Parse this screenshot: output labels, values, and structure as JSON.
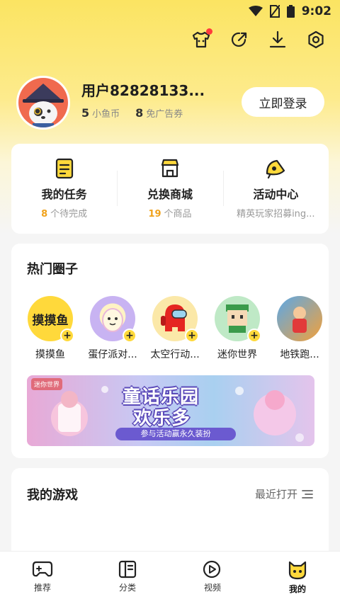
{
  "status_bar": {
    "time": "9:02"
  },
  "profile": {
    "username": "用户82828133...",
    "coins_value": "5",
    "coins_label": "小鱼币",
    "adfree_value": "8",
    "adfree_label": "免广告券",
    "login_label": "立即登录"
  },
  "quick": [
    {
      "title": "我的任务",
      "num": "8",
      "sub": "个待完成",
      "icon": "task-icon"
    },
    {
      "title": "兑换商城",
      "num": "19",
      "sub": "个商品",
      "icon": "shop-icon"
    },
    {
      "title": "活动中心",
      "num": "",
      "sub": "精英玩家招募ing...",
      "icon": "activity-icon"
    }
  ],
  "hot_circles": {
    "title": "热门圈子",
    "items": [
      {
        "name": "摸摸鱼",
        "icon_text": "摸摸鱼"
      },
      {
        "name": "蛋仔派对..."
      },
      {
        "name": "太空行动..."
      },
      {
        "name": "迷你世界"
      },
      {
        "name": "地铁跑..."
      }
    ],
    "banner": {
      "logo": "迷你世界",
      "title_line1": "童话乐园",
      "title_line2": "欢乐多",
      "subtitle": "参与活动赢永久装扮"
    }
  },
  "my_games": {
    "title": "我的游戏",
    "recent_label": "最近打开"
  },
  "bottom_nav": [
    {
      "label": "推荐",
      "icon": "gamepad-icon"
    },
    {
      "label": "分类",
      "icon": "category-icon"
    },
    {
      "label": "视频",
      "icon": "video-icon"
    },
    {
      "label": "我的",
      "icon": "mine-icon",
      "active": true
    }
  ],
  "colors": {
    "accent": "#fbe462",
    "highlight_number": "#f0a21b",
    "badge_red": "#ff3b3b"
  }
}
